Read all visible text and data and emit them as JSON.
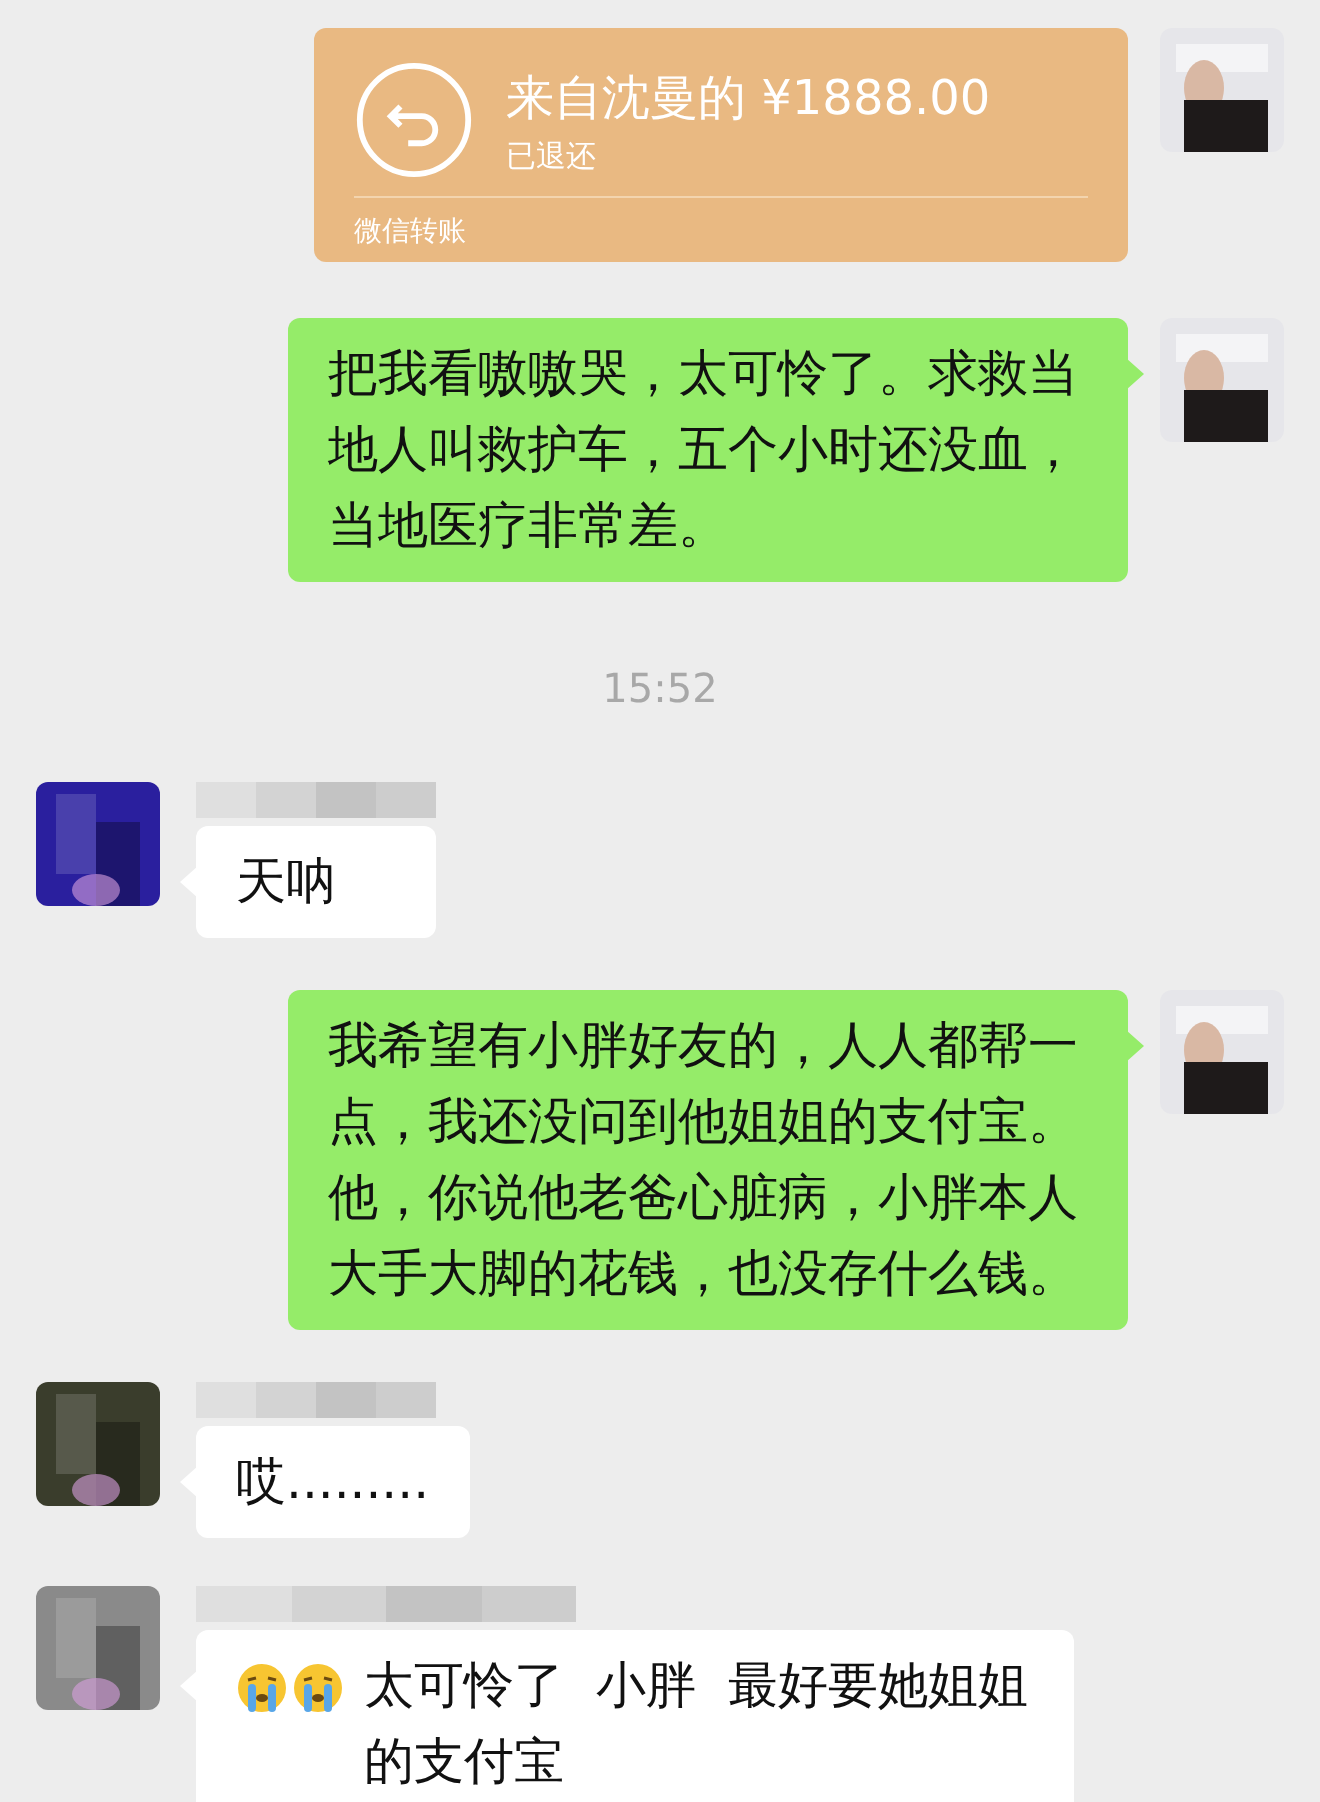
{
  "messages": [
    {
      "kind": "transfer",
      "outgoing": true,
      "title": "来自沈曼的 ¥1888.00",
      "status": "已退还",
      "footer": "微信转账"
    },
    {
      "kind": "text",
      "outgoing": true,
      "text": "把我看嗷嗷哭，太可怜了。求救当地人叫救护车，五个小时还没血，当地医疗非常差。"
    },
    {
      "kind": "time",
      "text": "15:52"
    },
    {
      "kind": "text",
      "outgoing": false,
      "text": "天呐"
    },
    {
      "kind": "text",
      "outgoing": true,
      "text": "我希望有小胖好友的，人人都帮一点，我还没问到他姐姐的支付宝。他，你说他老爸心脏病，小胖本人大手大脚的花钱，也没存什么钱。"
    },
    {
      "kind": "text",
      "outgoing": false,
      "text": "哎........."
    },
    {
      "kind": "text",
      "outgoing": false,
      "text": "太可怜了  小胖  最好要她姐姐的支付宝",
      "emojis": [
        {
          "kind": "crying"
        },
        {
          "kind": "crying"
        }
      ]
    }
  ]
}
